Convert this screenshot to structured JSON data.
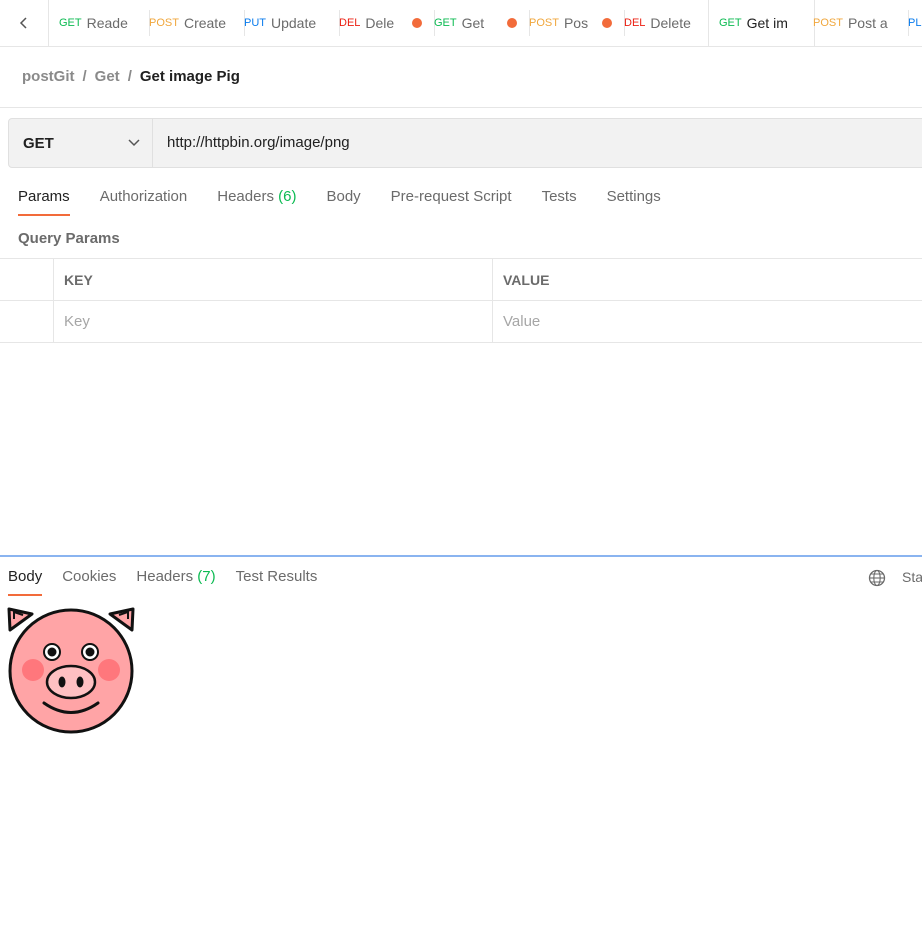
{
  "tabs": [
    {
      "method": "GET",
      "label": "Reade",
      "dot": false
    },
    {
      "method": "POST",
      "label": "Create",
      "dot": false
    },
    {
      "method": "PUT",
      "label": "Update",
      "dot": false
    },
    {
      "method": "DEL",
      "label": "Dele",
      "dot": true
    },
    {
      "method": "GET",
      "label": "Get",
      "dot": true
    },
    {
      "method": "POST",
      "label": "Pos",
      "dot": true
    },
    {
      "method": "DEL",
      "label": "Delete",
      "dot": false
    },
    {
      "method": "GET",
      "label": "Get im",
      "dot": false,
      "active": true
    },
    {
      "method": "POST",
      "label": "Post a",
      "dot": false
    },
    {
      "method": "PL",
      "label": "",
      "dot": false
    }
  ],
  "breadcrumb": {
    "collection": "postGit",
    "folder": "Get",
    "request": "Get image Pig"
  },
  "request": {
    "method": "GET",
    "url": "http://httpbin.org/image/png"
  },
  "req_tabs": {
    "params": "Params",
    "authorization": "Authorization",
    "headers": "Headers",
    "headers_count": "(6)",
    "body": "Body",
    "prerequest": "Pre-request Script",
    "tests": "Tests",
    "settings": "Settings"
  },
  "query_params": {
    "title": "Query Params",
    "key_header": "KEY",
    "value_header": "VALUE",
    "key_placeholder": "Key",
    "value_placeholder": "Value"
  },
  "response": {
    "body": "Body",
    "cookies": "Cookies",
    "headers": "Headers",
    "headers_count": "(7)",
    "test_results": "Test Results",
    "status_label": "Sta"
  },
  "colors": {
    "accent": "#f26b3a",
    "get": "#0cbb52",
    "post": "#f0a73d",
    "put": "#097bed",
    "del": "#eb2013",
    "pig_pink": "#ffa4a6"
  }
}
